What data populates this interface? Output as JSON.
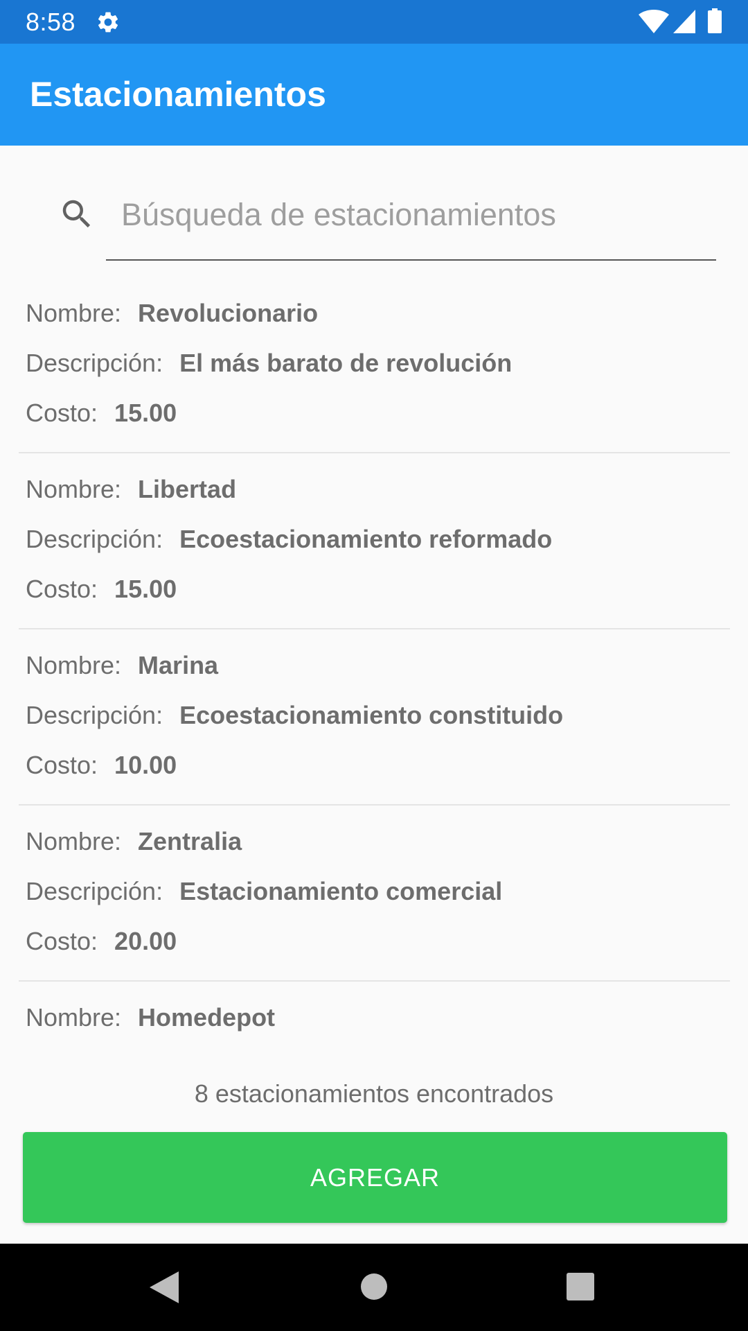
{
  "status_bar": {
    "time": "8:58",
    "icons": [
      "gear-icon",
      "wifi-icon",
      "signal-icon",
      "battery-icon"
    ]
  },
  "app_bar": {
    "title": "Estacionamientos",
    "color": "#2196f3"
  },
  "search": {
    "placeholder": "Búsqueda de estacionamientos",
    "value": ""
  },
  "labels": {
    "name": "Nombre:",
    "description": "Descripción:",
    "cost": "Costo:"
  },
  "parkings": [
    {
      "name": "Revolucionario",
      "description": "El más barato de revolución",
      "cost": "15.00"
    },
    {
      "name": "Libertad",
      "description": "Ecoestacionamiento reformado",
      "cost": "15.00"
    },
    {
      "name": "Marina",
      "description": "Ecoestacionamiento constituido",
      "cost": "10.00"
    },
    {
      "name": "Zentralia",
      "description": "Estacionamiento comercial",
      "cost": "20.00"
    },
    {
      "name": "Homedepot"
    }
  ],
  "footer": {
    "count_text": "8 estacionamientos encontrados",
    "add_label": "AGREGAR",
    "add_color": "#34c759"
  },
  "nav_bar": {
    "icons": [
      "back-icon",
      "home-icon",
      "recents-icon"
    ]
  }
}
